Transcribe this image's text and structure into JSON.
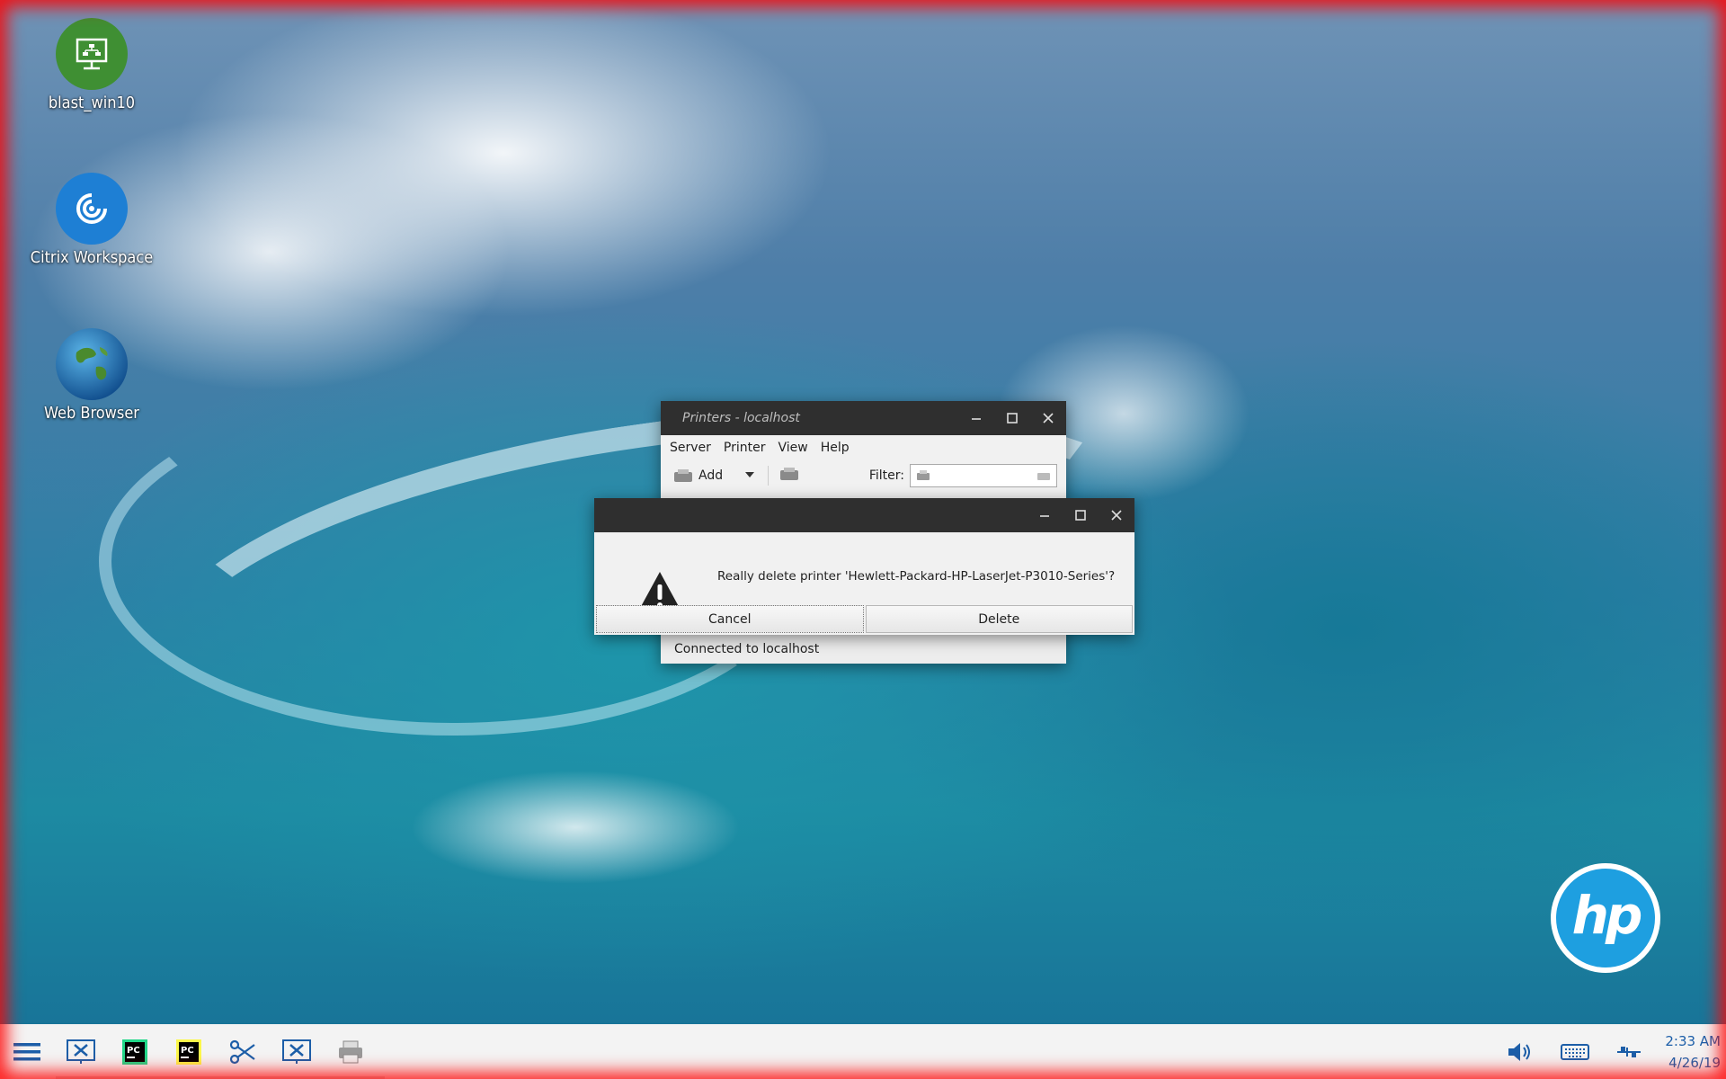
{
  "desktop": {
    "icons": [
      {
        "label": "blast_win10",
        "icon": "monitor-network-icon"
      },
      {
        "label": "Citrix Workspace",
        "icon": "citrix-icon"
      },
      {
        "label": "Web Browser",
        "icon": "globe-icon"
      }
    ],
    "logo": {
      "text": "hp",
      "color": "#1e9fe0"
    }
  },
  "printers_window": {
    "title": "Printers - localhost",
    "menu": [
      "Server",
      "Printer",
      "View",
      "Help"
    ],
    "toolbar": {
      "add_label": "Add",
      "filter_label": "Filter:",
      "filter_value": ""
    },
    "status": "Connected to localhost"
  },
  "dialog": {
    "message": "Really delete printer 'Hewlett-Packard-HP-LaserJet-P3010-Series'?",
    "cancel_label": "Cancel",
    "delete_label": "Delete"
  },
  "taskbar": {
    "items": [
      "menu-icon",
      "citrix-session-icon",
      "pycharm-icon",
      "pycharm-icon",
      "snipping-tool-icon",
      "citrix-session-icon",
      "printer-icon"
    ],
    "time": "2:33 AM",
    "date": "4/26/19"
  },
  "colors": {
    "titlebar": "#2f2f2f",
    "window_bg": "#f1f1f1",
    "frame_border": "#ff0000"
  }
}
